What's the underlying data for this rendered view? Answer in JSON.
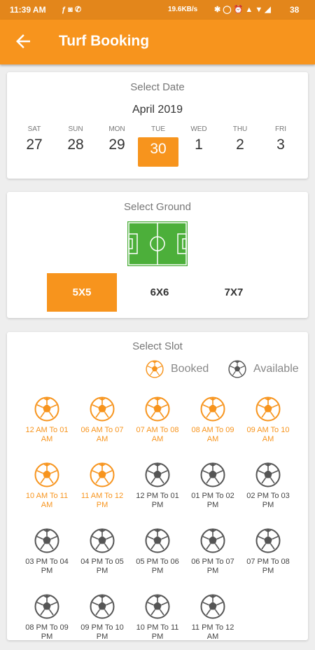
{
  "status_bar": {
    "time": "11:39 AM",
    "speed": "19.6KB/s",
    "battery": "38"
  },
  "app_bar": {
    "title": "Turf Booking",
    "back_icon": "arrow-left-icon"
  },
  "date_section": {
    "title": "Select Date",
    "month": "April 2019",
    "days": [
      {
        "name": "SAT",
        "date": "27",
        "selected": false
      },
      {
        "name": "SUN",
        "date": "28",
        "selected": false
      },
      {
        "name": "MON",
        "date": "29",
        "selected": false
      },
      {
        "name": "TUE",
        "date": "30",
        "selected": true
      },
      {
        "name": "WED",
        "date": "1",
        "selected": false
      },
      {
        "name": "THU",
        "date": "2",
        "selected": false
      },
      {
        "name": "FRI",
        "date": "3",
        "selected": false
      }
    ]
  },
  "ground_section": {
    "title": "Select Ground",
    "field_icon": "football-field-icon",
    "options": [
      {
        "label": "5X5",
        "selected": true
      },
      {
        "label": "6X6",
        "selected": false
      },
      {
        "label": "7X7",
        "selected": false
      }
    ]
  },
  "slot_section": {
    "title": "Select Slot",
    "legend": {
      "booked": "Booked",
      "available": "Available"
    },
    "slots": [
      {
        "label": "12 AM To 01 AM",
        "booked": true
      },
      {
        "label": "06 AM To 07 AM",
        "booked": true
      },
      {
        "label": "07 AM To 08 AM",
        "booked": true
      },
      {
        "label": "08 AM To 09 AM",
        "booked": true
      },
      {
        "label": "09 AM To 10 AM",
        "booked": true
      },
      {
        "label": "10 AM To 11 AM",
        "booked": true
      },
      {
        "label": "11 AM To 12 PM",
        "booked": true
      },
      {
        "label": "12 PM To 01 PM",
        "booked": false
      },
      {
        "label": "01 PM To 02 PM",
        "booked": false
      },
      {
        "label": "02 PM To 03 PM",
        "booked": false
      },
      {
        "label": "03 PM To 04 PM",
        "booked": false
      },
      {
        "label": "04 PM To 05 PM",
        "booked": false
      },
      {
        "label": "05 PM To 06 PM",
        "booked": false
      },
      {
        "label": "06 PM To 07 PM",
        "booked": false
      },
      {
        "label": "07 PM To 08 PM",
        "booked": false
      },
      {
        "label": "08 PM To 09 PM",
        "booked": false
      },
      {
        "label": "09 PM To 10 PM",
        "booked": false
      },
      {
        "label": "10 PM To 11 PM",
        "booked": false
      },
      {
        "label": "11 PM To 12 AM",
        "booked": false
      }
    ]
  },
  "colors": {
    "accent": "#f7941d",
    "booked": "#f7941d",
    "available": "#555555",
    "field": "#4caf3a"
  }
}
